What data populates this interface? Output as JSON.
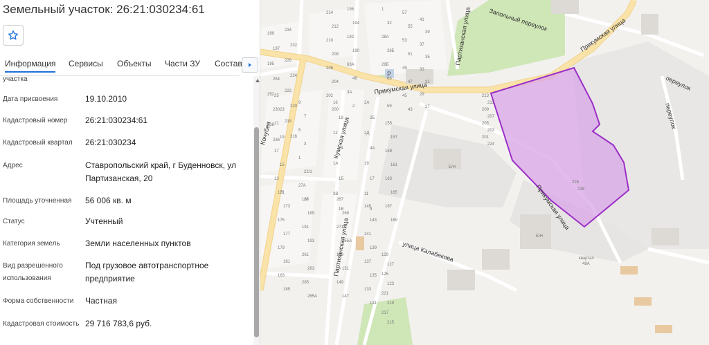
{
  "panel": {
    "title": "Земельный участок: 26:21:030234:61",
    "favorite_icon": "star-outline-icon",
    "tabs": [
      {
        "label": "Информация"
      },
      {
        "label": "Сервисы"
      },
      {
        "label": "Объекты"
      },
      {
        "label": "Части ЗУ"
      },
      {
        "label": "Состав"
      }
    ],
    "tab_next_icon": "chevron-right-icon",
    "partial_label": "участка",
    "rows": [
      {
        "label": "Дата присвоения",
        "value": "19.10.2010"
      },
      {
        "label": "Кадастровый номер",
        "value": "26:21:030234:61"
      },
      {
        "label": "Кадастровый квартал",
        "value": "26:21:030234"
      },
      {
        "label": "Адрес",
        "value": "Ставропольский край, г Буденновск, ул Партизанская, 20"
      },
      {
        "label": "Площадь уточненная",
        "value": "56 006 кв. м"
      },
      {
        "label": "Статус",
        "value": "Учтенный"
      },
      {
        "label": "Категория земель",
        "value": "Земли населенных пунктов"
      },
      {
        "label": "Вид разрешенного использования",
        "value": "Под грузовое автотранспортное предприятие"
      },
      {
        "label": "Форма собственности",
        "value": "Частная"
      },
      {
        "label": "Кадастровая стоимость",
        "value": "29 716 783,6 руб."
      }
    ]
  },
  "map": {
    "streets": {
      "prikumskaya_1": "Прикумская улица",
      "prikumskaya_2": "Прикумская улица",
      "prikumskaya_3": "Прикумская улица",
      "partizanskaya_1": "Партизанская улица",
      "partizanskaya_2": "Партизанская улица",
      "kumskaya": "Кумская улица",
      "kalabekova": "улица Калабекова",
      "kochubeya": "Кочубея",
      "zapolny": "Запольный переулок",
      "pereulok": "переулок",
      "pereulok_2": "переулок"
    },
    "labels": {
      "kvartal": "квартал",
      "kvartal_num": "48А",
      "parking": "P",
      "bn1": "Б/Н",
      "bn2": "Б/Н"
    },
    "house_numbers": [
      "199",
      "197",
      "195",
      "254",
      "252",
      "230",
      "238",
      "236",
      "234",
      "232",
      "226",
      "224",
      "222",
      "220",
      "218",
      "216",
      "214",
      "212",
      "210",
      "208",
      "206",
      "204",
      "202",
      "200",
      "196",
      "194",
      "192",
      "190",
      "63А",
      "48",
      "3А",
      "2",
      "1",
      "32",
      "28А",
      "28Б",
      "29Б",
      "63",
      "61",
      "59",
      "57",
      "55",
      "53",
      "51",
      "49",
      "47",
      "45",
      "43",
      "41",
      "39",
      "37",
      "35",
      "33",
      "31",
      "29",
      "27",
      "25",
      "23",
      "21",
      "19",
      "17",
      "15",
      "13",
      "11",
      "9",
      "7",
      "5",
      "3",
      "1",
      "22/1",
      "27А",
      "28",
      "16",
      "18",
      "12",
      "14",
      "1А",
      "1Б",
      "3В",
      "1В",
      "2А",
      "2Б",
      "2Д",
      "4А",
      "19",
      "17",
      "11",
      "9",
      "155",
      "157",
      "159",
      "161",
      "163",
      "165",
      "167",
      "169",
      "171",
      "173",
      "175",
      "177",
      "179",
      "181",
      "183",
      "185",
      "187",
      "189",
      "191",
      "193",
      "261",
      "263",
      "265",
      "265А",
      "267",
      "269",
      "271",
      "155А",
      "153",
      "151",
      "149",
      "147",
      "145",
      "143",
      "141",
      "139",
      "137",
      "135",
      "133",
      "131",
      "129",
      "127",
      "125",
      "123",
      "221",
      "219",
      "217",
      "215",
      "213",
      "211",
      "209",
      "207",
      "205",
      "203",
      "201",
      "224",
      "226",
      "228"
    ],
    "parcel_color": "#d9a6e8",
    "parcel_stroke": "#9b2fc7"
  }
}
